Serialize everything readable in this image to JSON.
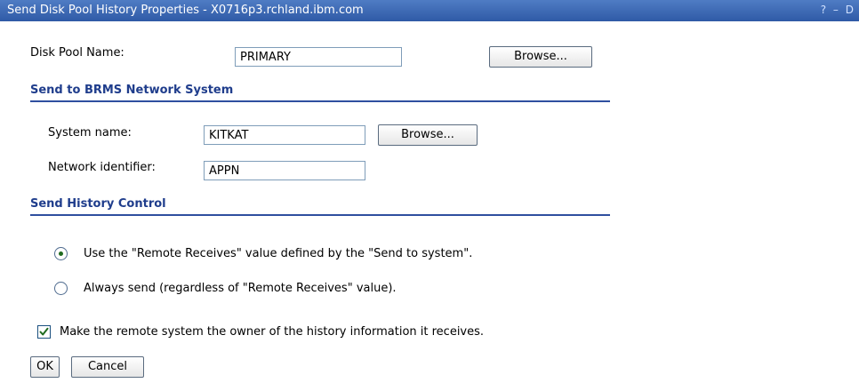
{
  "window": {
    "title": "Send Disk Pool History Properties - X0716p3.rchland.ibm.com",
    "help_icon": "?",
    "minimize_icon": "–",
    "maximize_icon": "D"
  },
  "disk_pool": {
    "label": "Disk Pool Name:",
    "value": "PRIMARY",
    "browse_label": "Browse..."
  },
  "network_section": {
    "title": "Send to BRMS Network System",
    "system_name_label": "System name:",
    "system_name_value": "KITKAT",
    "browse_label": "Browse...",
    "network_id_label": "Network identifier:",
    "network_id_value": "APPN"
  },
  "history_section": {
    "title": "Send History Control",
    "options": [
      {
        "label": "Use the \"Remote Receives\" value defined by the \"Send to system\".",
        "selected": true
      },
      {
        "label": "Always send (regardless of \"Remote Receives\" value).",
        "selected": false
      }
    ]
  },
  "owner_checkbox": {
    "label": "Make the remote system the owner of the history information it receives.",
    "checked": true
  },
  "actions": {
    "ok_label": "OK",
    "cancel_label": "Cancel"
  }
}
